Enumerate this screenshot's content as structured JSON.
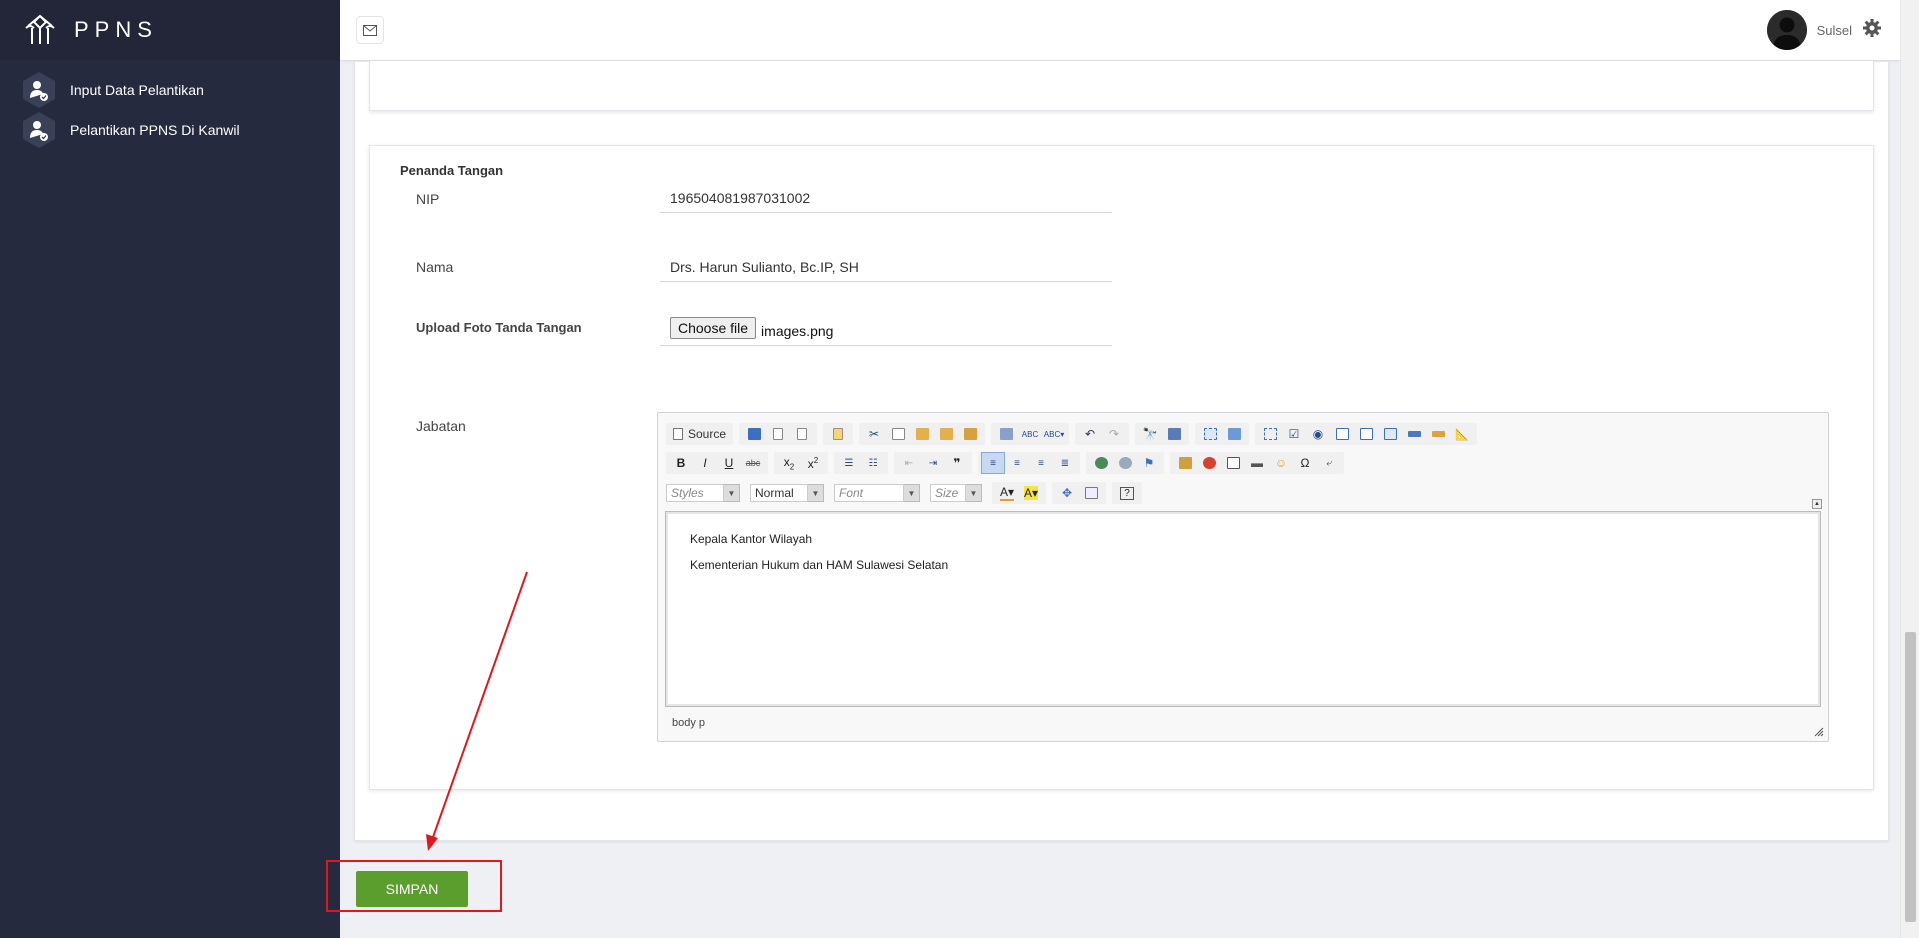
{
  "brand": {
    "name": "PPNS"
  },
  "sidebar": {
    "items": [
      {
        "label": "Input Data Pelantikan"
      },
      {
        "label": "Pelantikan PPNS Di Kanwil"
      }
    ]
  },
  "topbar": {
    "username": "Sulsel"
  },
  "signature_section": {
    "title": "Penanda Tangan",
    "nip_label": "NIP",
    "nip_value": "196504081987031002",
    "nama_label": "Nama",
    "nama_value": "Drs. Harun Sulianto, Bc.IP, SH",
    "upload_label": "Upload Foto Tanda Tangan",
    "file_button": "Choose file",
    "file_name": "images.png",
    "jabatan_label": "Jabatan"
  },
  "editor": {
    "source_label": "Source",
    "styles_placeholder": "Styles",
    "format_value": "Normal",
    "font_placeholder": "Font",
    "size_placeholder": "Size",
    "content_lines": [
      "Kepala Kantor Wilayah",
      "Kementerian Hukum dan HAM Sulawesi Selatan"
    ],
    "path": "body  p"
  },
  "actions": {
    "save_label": "SIMPAN"
  },
  "colors": {
    "sidebar": "#252a3f",
    "save": "#5c9e2e",
    "annotation": "#e3161c"
  }
}
